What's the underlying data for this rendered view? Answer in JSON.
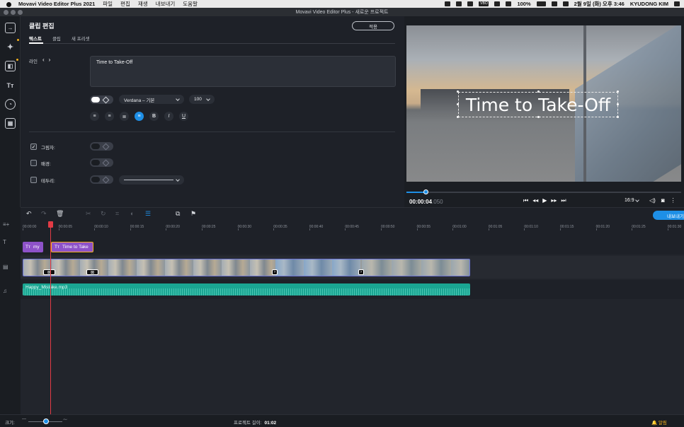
{
  "menubar": {
    "app_name": "Movavi Video Editor Plus 2021",
    "items": [
      "파일",
      "편집",
      "재생",
      "내보내기",
      "도움말"
    ],
    "battery": "100%",
    "datetime": "2월 9일 (화) 오후 3:46",
    "user": "KYUDONG KIM",
    "badge": "VBO"
  },
  "window": {
    "title": "Movavi Video Editor Plus - 새로운 프로젝트"
  },
  "panel": {
    "title": "클립 편집",
    "apply_label": "적용",
    "tabs": [
      "텍스트",
      "클립",
      "새 프리셋"
    ],
    "line_label": "라인",
    "text_value": "Time to Take-Off",
    "font_name": "Verdana – 기본",
    "font_size": "100",
    "shadow_label": "그림자:",
    "background_label": "배경:",
    "border_label": "테두리:"
  },
  "preview": {
    "overlay_text": "Time to Take-Off",
    "timecode_main": "00:00:04",
    "timecode_ms": ".050",
    "aspect": "16:9",
    "progress_fraction": 0.07
  },
  "toolbar": {
    "export_label": "내보내기"
  },
  "ruler": {
    "ticks": [
      "00:00:00",
      "00:00:05",
      "00:00:10",
      "00:00:15",
      "00:00:20",
      "00:00:25",
      "00:00:30",
      "00:00:35",
      "00:00:40",
      "00:00:45",
      "00:00:50",
      "00:00:55",
      "00:01:00",
      "00:01:05",
      "00:01:10",
      "00:01:15",
      "00:01:20",
      "00:01:25",
      "00:01:30"
    ]
  },
  "timeline": {
    "title_clips": [
      "my",
      "Time to Take"
    ],
    "audio_clip": "Happy_Mistake.mp3"
  },
  "status": {
    "size_label": "크기:",
    "project_length_label": "프로젝트 길이:",
    "project_length": "01:02",
    "notifications_label": "알림"
  },
  "colors": {
    "accent": "#1e8fe6",
    "title_clip": "#8e52c9",
    "audio_clip": "#1aa592",
    "playhead": "#e23b45"
  }
}
